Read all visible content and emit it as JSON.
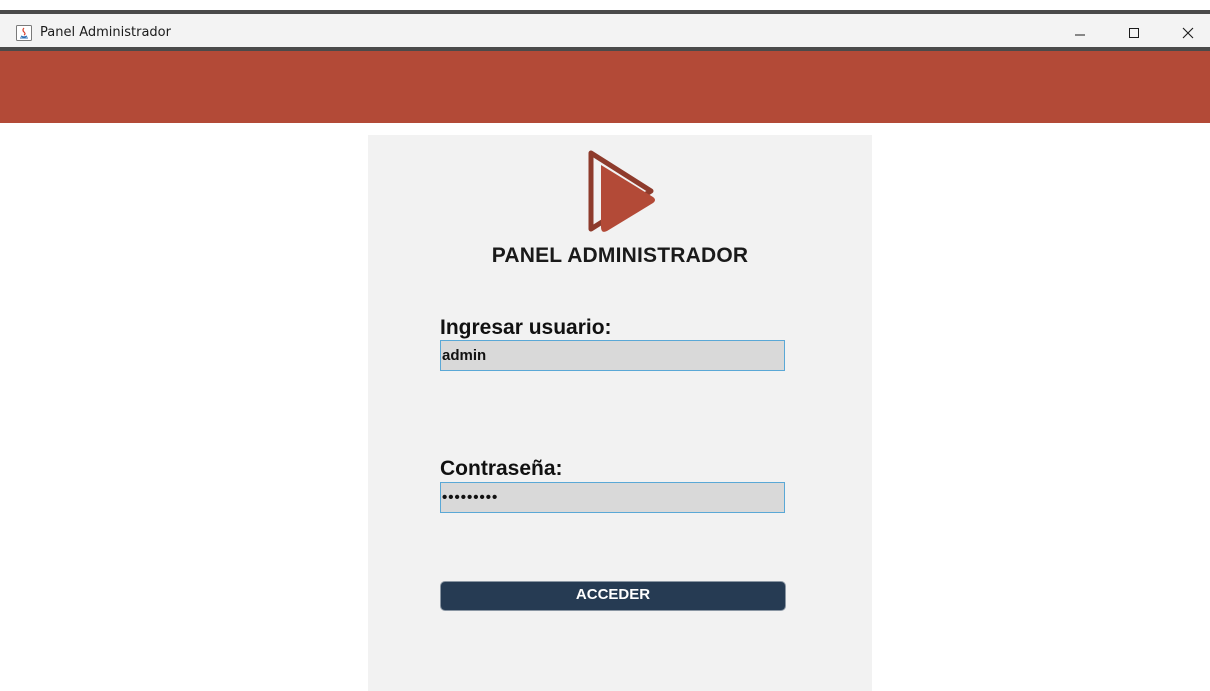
{
  "window": {
    "title": "Panel Administrador",
    "controls": {
      "minimize": "minimize-icon",
      "maximize": "maximize-icon",
      "close": "close-icon"
    }
  },
  "colors": {
    "banner": "#b34a37",
    "card": "#f2f2f2",
    "logo": "#b34a37",
    "button": "#263b53",
    "field_bg": "#d9d9d9",
    "field_border": "#5aa8d6"
  },
  "login": {
    "logo_icon": "play-logo-icon",
    "title": "PANEL ADMINISTRADOR",
    "user_label": "Ingresar usuario:",
    "user_value": "admin",
    "pass_label": "Contraseña:",
    "pass_value": "•••••••••",
    "submit_label": "ACCEDER"
  }
}
